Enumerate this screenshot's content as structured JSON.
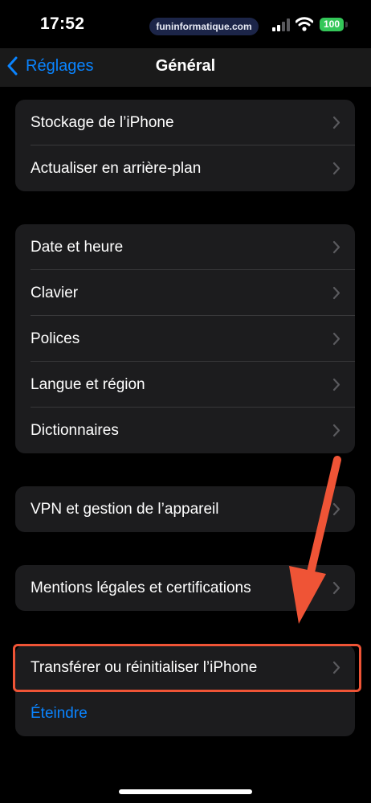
{
  "status_bar": {
    "time": "17:52",
    "watermark": "funinformatique.com",
    "battery": "100"
  },
  "nav": {
    "back_label": "Réglages",
    "title": "Général"
  },
  "groups": [
    {
      "items": [
        {
          "label": "Stockage de l’iPhone"
        },
        {
          "label": "Actualiser en arrière-plan"
        }
      ]
    },
    {
      "items": [
        {
          "label": "Date et heure"
        },
        {
          "label": "Clavier"
        },
        {
          "label": "Polices"
        },
        {
          "label": "Langue et région"
        },
        {
          "label": "Dictionnaires"
        }
      ]
    },
    {
      "items": [
        {
          "label": "VPN et gestion de l’appareil"
        }
      ]
    },
    {
      "items": [
        {
          "label": "Mentions légales et certifications"
        }
      ]
    },
    {
      "items": [
        {
          "label": "Transférer ou réinitialiser l’iPhone"
        },
        {
          "label": "Éteindre"
        }
      ]
    }
  ],
  "colors": {
    "background": "#000000",
    "cell": "#1c1c1e",
    "accent": "#0a84ff",
    "annotation": "#ef5436",
    "battery": "#34c759"
  }
}
